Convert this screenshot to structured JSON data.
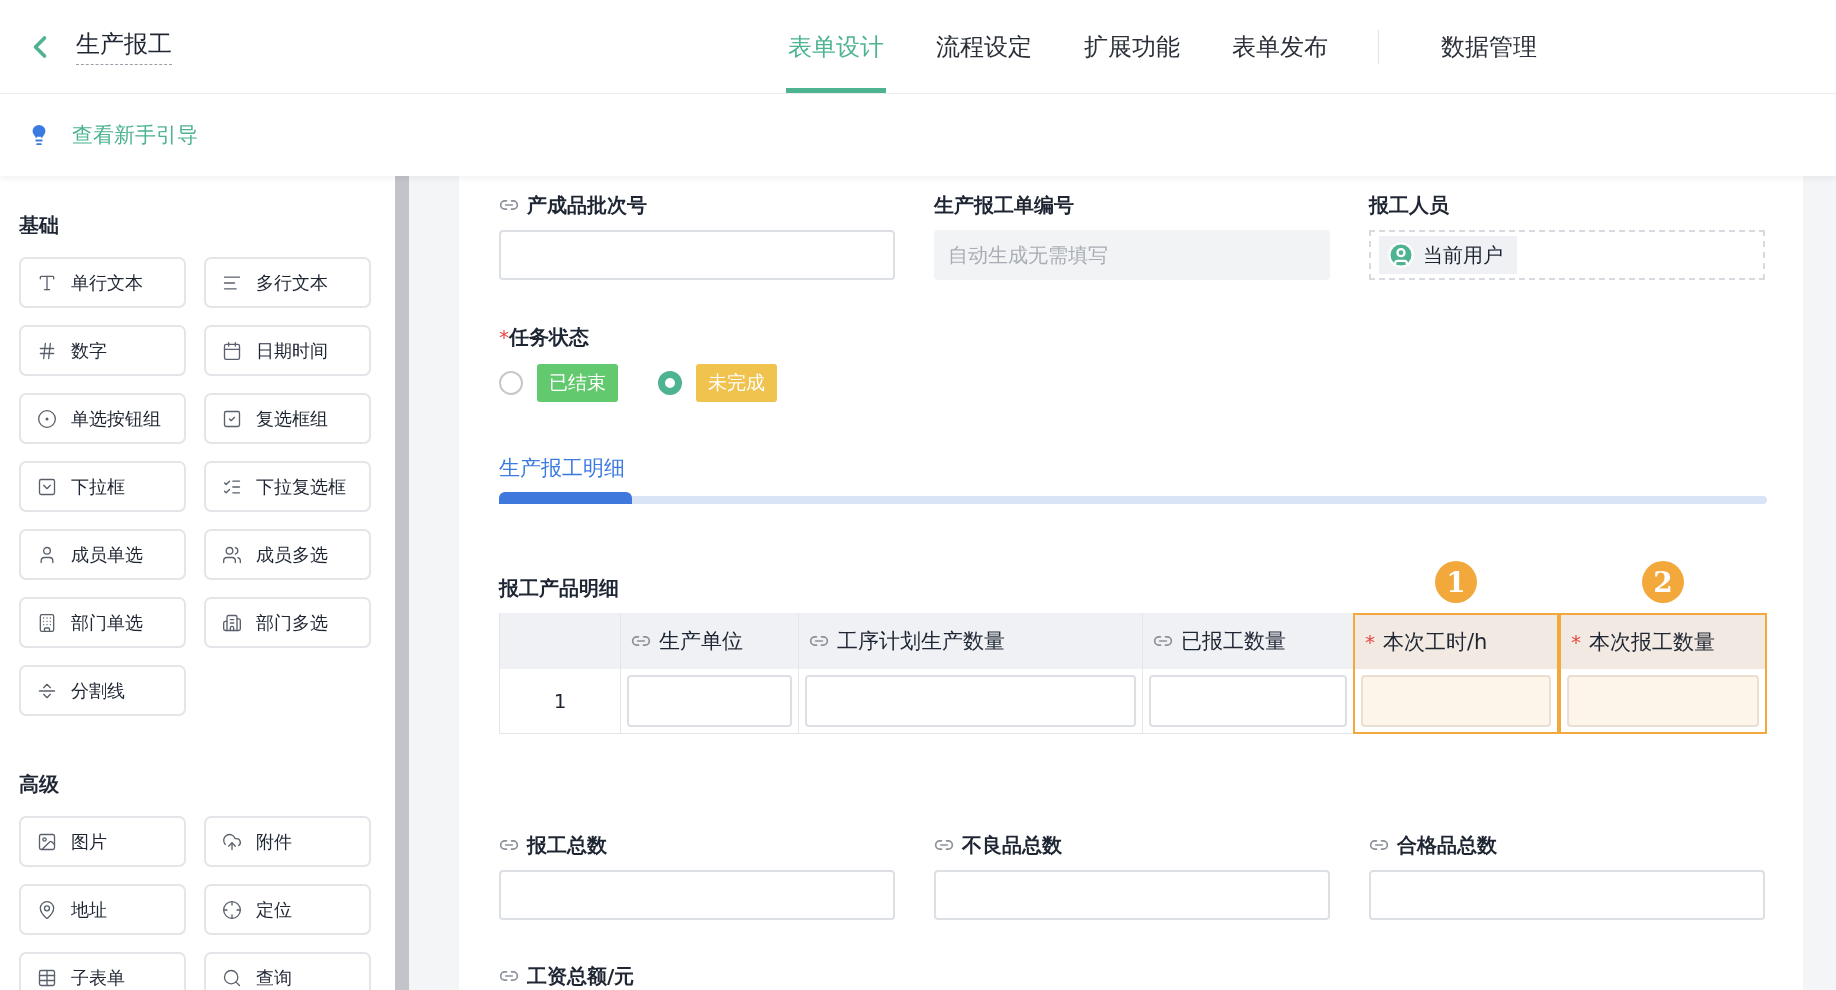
{
  "header": {
    "title": "生产报工",
    "tabs": [
      {
        "label": "表单设计",
        "selected": true
      },
      {
        "label": "流程设定",
        "selected": false
      },
      {
        "label": "扩展功能",
        "selected": false
      },
      {
        "label": "表单发布",
        "selected": false
      },
      {
        "label": "数据管理",
        "selected": false
      }
    ]
  },
  "guide": {
    "label": "查看新手引导"
  },
  "sidebar": {
    "groups": [
      {
        "title": "基础",
        "items": [
          {
            "label": "单行文本",
            "kind": "text"
          },
          {
            "label": "多行文本",
            "kind": "textarea"
          },
          {
            "label": "数字",
            "kind": "number"
          },
          {
            "label": "日期时间",
            "kind": "date"
          },
          {
            "label": "单选按钮组",
            "kind": "radio"
          },
          {
            "label": "复选框组",
            "kind": "checkbox"
          },
          {
            "label": "下拉框",
            "kind": "select"
          },
          {
            "label": "下拉复选框",
            "kind": "multiselect"
          },
          {
            "label": "成员单选",
            "kind": "member"
          },
          {
            "label": "成员多选",
            "kind": "members"
          },
          {
            "label": "部门单选",
            "kind": "dept"
          },
          {
            "label": "部门多选",
            "kind": "depts"
          },
          {
            "label": "分割线",
            "kind": "divider"
          }
        ]
      },
      {
        "title": "高级",
        "items": [
          {
            "label": "图片",
            "kind": "image"
          },
          {
            "label": "附件",
            "kind": "upload"
          },
          {
            "label": "地址",
            "kind": "address"
          },
          {
            "label": "定位",
            "kind": "location"
          },
          {
            "label": "子表单",
            "kind": "subform"
          },
          {
            "label": "查询",
            "kind": "query"
          }
        ]
      }
    ]
  },
  "form": {
    "top_fields": [
      {
        "label": "产成品批次号",
        "linked": true,
        "kind": "input"
      },
      {
        "label": "生产报工单编号",
        "linked": false,
        "kind": "auto",
        "placeholder": "自动生成无需填写"
      },
      {
        "label": "报工人员",
        "linked": false,
        "kind": "user",
        "value": "当前用户"
      }
    ],
    "status": {
      "label": "任务状态",
      "required_mark": "*",
      "options": [
        {
          "label": "已结束",
          "selected": false,
          "color": "#63c96f"
        },
        {
          "label": "未完成",
          "selected": true,
          "color": "#f0c24e"
        }
      ]
    },
    "detail_tabs": [
      {
        "label": "生产报工明细",
        "selected": true
      }
    ],
    "table": {
      "title": "报工产品明细",
      "columns": [
        {
          "label": "生产单位",
          "linked": true,
          "highlighted": false
        },
        {
          "label": "工序计划生产数量",
          "linked": true,
          "highlighted": false
        },
        {
          "label": "已报工数量",
          "linked": true,
          "highlighted": false
        },
        {
          "label": "本次工时/h",
          "linked": false,
          "required_mark": "*",
          "highlighted": true,
          "badge": "1"
        },
        {
          "label": "本次报工数量",
          "linked": false,
          "required_mark": "*",
          "highlighted": true,
          "badge": "2"
        }
      ],
      "rows": [
        {
          "number": "1"
        }
      ]
    },
    "total_fields": [
      {
        "label": "报工总数",
        "linked": true
      },
      {
        "label": "不良品总数",
        "linked": true
      },
      {
        "label": "合格品总数",
        "linked": true
      },
      {
        "label": "工资总额/元",
        "linked": true
      }
    ]
  }
}
